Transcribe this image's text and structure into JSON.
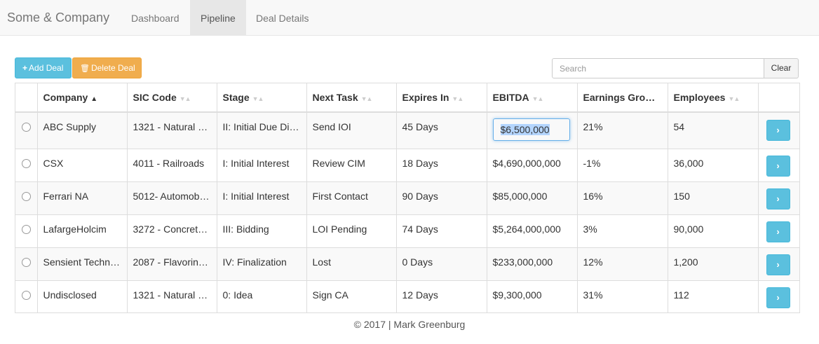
{
  "navbar": {
    "brand": "Some & Company",
    "tabs": [
      {
        "label": "Dashboard",
        "active": false
      },
      {
        "label": "Pipeline",
        "active": true
      },
      {
        "label": "Deal Details",
        "active": false
      }
    ]
  },
  "toolbar": {
    "add_icon": "+",
    "add_label": "Add Deal",
    "delete_icon": "🗑",
    "delete_label": "Delete Deal",
    "search_placeholder": "Search",
    "search_value": "",
    "clear_label": "Clear"
  },
  "table": {
    "columns": [
      {
        "label": "Company",
        "sort": "asc"
      },
      {
        "label": "SIC Code",
        "sort": "none"
      },
      {
        "label": "Stage",
        "sort": "none"
      },
      {
        "label": "Next Task",
        "sort": "none"
      },
      {
        "label": "Expires In",
        "sort": "none"
      },
      {
        "label": "EBITDA",
        "sort": "none"
      },
      {
        "label": "Earnings Grow…",
        "sort": "none"
      },
      {
        "label": "Employees",
        "sort": "none"
      }
    ],
    "sort_icon_asc": "▲",
    "sort_icon_none": "▼▲",
    "rows": [
      {
        "company": "ABC Supply",
        "sic": "1321 - Natural …",
        "stage": "II: Initial Due Dil…",
        "next_task": "Send IOI",
        "expires": "45 Days",
        "ebitda": "$6,500,000",
        "growth": "21%",
        "employees": "54"
      },
      {
        "company": "CSX",
        "sic": "4011 - Railroads",
        "stage": "I: Initial Interest",
        "next_task": "Review CIM",
        "expires": "18 Days",
        "ebitda": "$4,690,000,000",
        "growth": "-1%",
        "employees": "36,000"
      },
      {
        "company": "Ferrari NA",
        "sic": "5012- Automob…",
        "stage": "I: Initial Interest",
        "next_task": "First Contact",
        "expires": "90 Days",
        "ebitda": "$85,000,000",
        "growth": "16%",
        "employees": "150"
      },
      {
        "company": "LafargeHolcim",
        "sic": "3272 - Concret…",
        "stage": "III: Bidding",
        "next_task": "LOI Pending",
        "expires": "74 Days",
        "ebitda": "$5,264,000,000",
        "growth": "3%",
        "employees": "90,000"
      },
      {
        "company": "Sensient Techn…",
        "sic": "2087 - Flavorin…",
        "stage": "IV: Finalization",
        "next_task": "Lost",
        "expires": "0 Days",
        "ebitda": "$233,000,000",
        "growth": "12%",
        "employees": "1,200"
      },
      {
        "company": "Undisclosed",
        "sic": "1321 - Natural …",
        "stage": "0: Idea",
        "next_task": "Sign CA",
        "expires": "12 Days",
        "ebitda": "$9,300,000",
        "growth": "31%",
        "employees": "112"
      }
    ],
    "editing_row": 0,
    "open_icon": "›"
  },
  "footer": {
    "text": "© 2017 | Mark Greenburg"
  },
  "colors": {
    "info": "#5bc0de",
    "warning": "#f0ad4e",
    "navbar_bg": "#f8f8f8",
    "active_tab_bg": "#e7e7e7"
  }
}
